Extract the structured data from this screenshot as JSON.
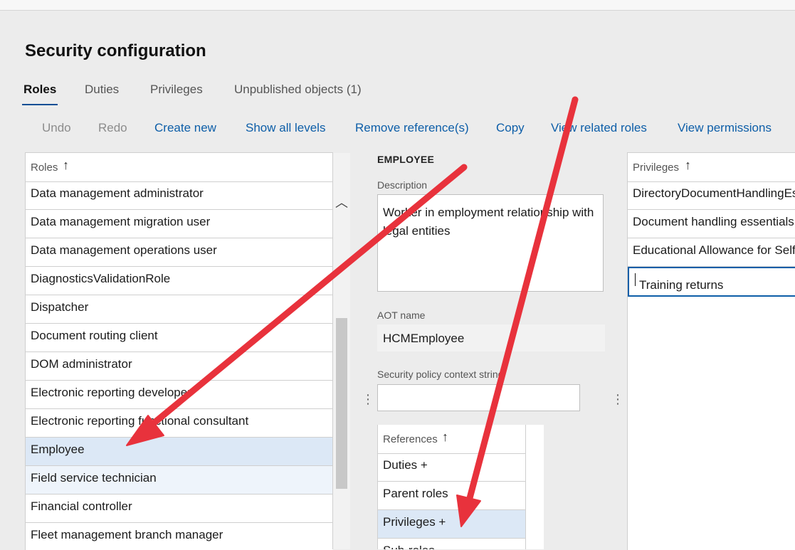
{
  "page": {
    "title": "Security configuration"
  },
  "tabs": [
    {
      "label": "Roles"
    },
    {
      "label": "Duties"
    },
    {
      "label": "Privileges"
    },
    {
      "label": "Unpublished objects (1)"
    }
  ],
  "toolbar": [
    {
      "label": "Undo",
      "enabled": false
    },
    {
      "label": "Redo",
      "enabled": false
    },
    {
      "label": "Create new",
      "enabled": true
    },
    {
      "label": "Show all levels",
      "enabled": true
    },
    {
      "label": "Remove reference(s)",
      "enabled": true
    },
    {
      "label": "Copy",
      "enabled": true
    },
    {
      "label": "View related roles",
      "enabled": true
    },
    {
      "label": "View permissions",
      "enabled": true
    }
  ],
  "roles_grid": {
    "header": "Roles",
    "sort_icon": "arrow-up-icon",
    "rows": [
      "Data management administrator",
      "Data management migration user",
      "Data management operations user",
      "DiagnosticsValidationRole",
      "Dispatcher",
      "Document routing client",
      "DOM administrator",
      "Electronic reporting developer",
      "Electronic reporting functional consultant",
      "Employee",
      "Field service technician",
      "Financial controller",
      "Fleet management branch manager"
    ],
    "selected": "Employee"
  },
  "detail": {
    "header": "EMPLOYEE",
    "description_label": "Description",
    "description": "Worker in employment relationship with legal entities",
    "aot_label": "AOT name",
    "aot_value": "HCMEmployee",
    "policy_label": "Security policy context string",
    "policy_value": ""
  },
  "references_grid": {
    "header": "References",
    "sort_icon": "arrow-up-icon",
    "rows": [
      "Duties +",
      "Parent roles",
      "Privileges +",
      "Sub-roles"
    ],
    "selected": "Privileges +"
  },
  "privileges_grid": {
    "header": "Privileges",
    "sort_icon": "arrow-up-icon",
    "rows": [
      "DirectoryDocumentHandlingEssentials",
      "Document handling essentials",
      "Educational Allowance for Self Service",
      "Training returns"
    ],
    "editing": "Training returns"
  },
  "annotations": {
    "arrow_color": "#e8323c"
  }
}
